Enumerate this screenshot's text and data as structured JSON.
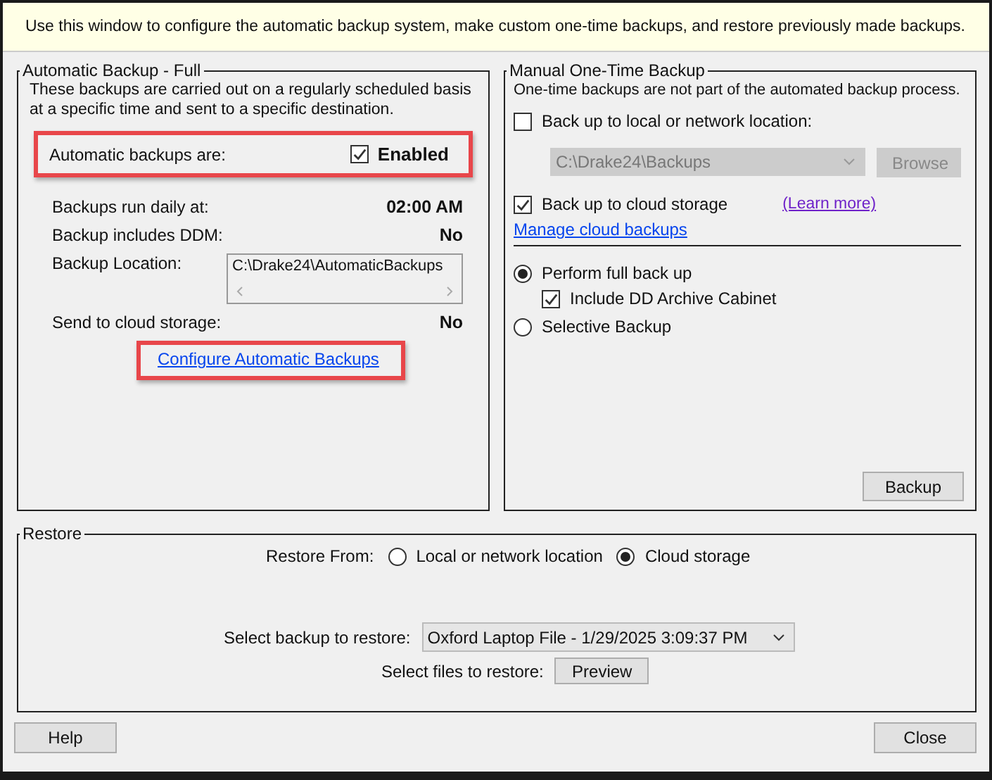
{
  "info_bar": {
    "text": "Use this window to configure the automatic backup system, make custom one-time backups, and restore previously made backups."
  },
  "automatic_backup": {
    "title": "Automatic Backup - Full",
    "description": "These backups are carried out on a regularly scheduled basis at a specific time and sent to a specific destination.",
    "status_label": "Automatic backups are:",
    "enabled": {
      "label": "Enabled",
      "checked": true,
      "highlighted": true
    },
    "rows": [
      {
        "kind": "value",
        "label": "Backups run daily at:",
        "value": "02:00 AM"
      },
      {
        "kind": "value",
        "label": "Backup includes DDM:",
        "value": "No"
      },
      {
        "kind": "path",
        "label": "Backup Location:",
        "value": "C:\\Drake24\\AutomaticBackups"
      },
      {
        "kind": "value",
        "label": "Send to cloud storage:",
        "value": "No"
      }
    ],
    "configure_link": {
      "label": "Configure Automatic Backups",
      "highlighted": true
    }
  },
  "manual_backup": {
    "title": "Manual One-Time Backup",
    "description": "One-time backups are not part of the automated backup process.",
    "local": {
      "label": "Back up to local or network location:",
      "checked": false,
      "path": "C:\\Drake24\\Backups",
      "browse": "Browse"
    },
    "cloud": {
      "label": "Back up to cloud storage",
      "checked": true,
      "learn_more": "(Learn more)",
      "manage": "Manage cloud backups"
    },
    "options": [
      {
        "label": "Perform full back up",
        "selected": true,
        "sub": {
          "label": "Include DD Archive Cabinet",
          "checked": true
        }
      },
      {
        "label": "Selective Backup",
        "selected": false
      }
    ],
    "backup_button": "Backup"
  },
  "restore": {
    "title": "Restore",
    "from_label": "Restore From:",
    "sources": [
      {
        "label": "Local or network location",
        "selected": false
      },
      {
        "label": "Cloud storage",
        "selected": true
      }
    ],
    "select_label": "Select backup to restore:",
    "selected_backup": "Oxford Laptop File - 1/29/2025 3:09:37 PM",
    "files_label": "Select files to restore:",
    "preview_button": "Preview"
  },
  "buttons": [
    "Help",
    "Close"
  ]
}
